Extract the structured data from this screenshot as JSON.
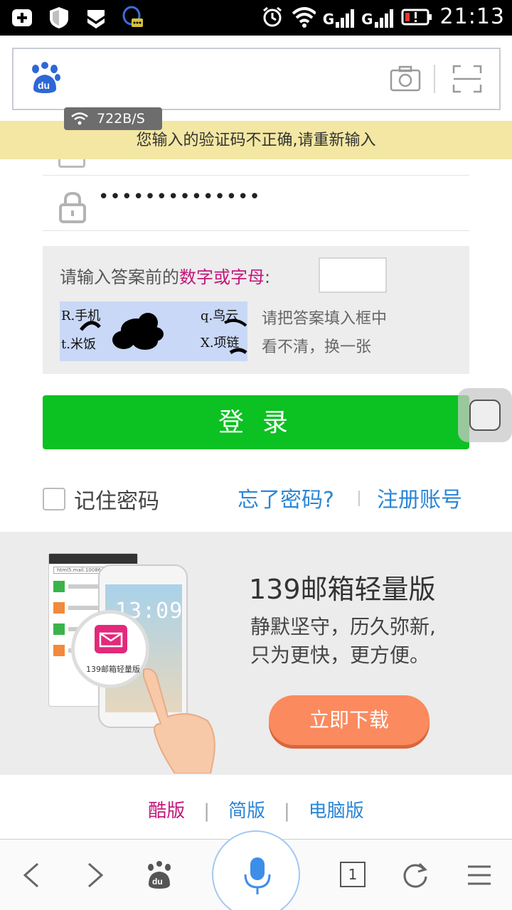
{
  "status_bar": {
    "time": "21:13",
    "left_icons": [
      "add-icon",
      "shield-icon",
      "vpn-icon",
      "qq-icon"
    ],
    "right_icons": [
      "alarm-icon",
      "wifi-icon",
      "signal-icon",
      "signal-icon",
      "battery-low-icon"
    ],
    "signal_label_1": "G",
    "signal_label_2": "G"
  },
  "browser": {
    "logo": "du",
    "network_speed": "722B/S",
    "icons": [
      "camera-icon",
      "scan-icon"
    ]
  },
  "error_message": "您输入的验证码不正确,请重新输入",
  "login": {
    "password_mask": "••••••••••••••",
    "captcha": {
      "prompt_prefix": "请输入答案前的",
      "prompt_highlight": "数字或字母",
      "prompt_suffix": ":",
      "options": [
        "R.手机",
        "q.鸟云",
        "t.米饭",
        "X.项链"
      ],
      "hint_fill": "请把答案填入框中",
      "hint_refresh": "看不清，换一张"
    },
    "submit_label": "登 录",
    "remember_label": "记住密码",
    "forgot_label": "忘了密码?",
    "register_label": "注册账号"
  },
  "promo": {
    "title": "139邮箱轻量版",
    "line1": "静默坚守，历久弥新,",
    "line2": "只为更快，更方便。",
    "download_label": "立即下载",
    "app_label": "139邮箱轻量版",
    "phone_time": "13:09",
    "phone_url": "html5.mail.10086.cn"
  },
  "versions": {
    "cool": "酷版",
    "simple": "简版",
    "pc": "电脑版",
    "separator": "|"
  },
  "toolbar": {
    "tab_count": "1",
    "icons": [
      "back-icon",
      "forward-icon",
      "baidu-icon",
      "mic-icon",
      "tabs-icon",
      "refresh-icon",
      "menu-icon"
    ]
  },
  "colors": {
    "accent_green": "#0cc122",
    "link_blue": "#2a86d6",
    "highlight_magenta": "#c3187a",
    "error_bg": "#f3e7a3",
    "download_orange": "#fb8a5e"
  }
}
